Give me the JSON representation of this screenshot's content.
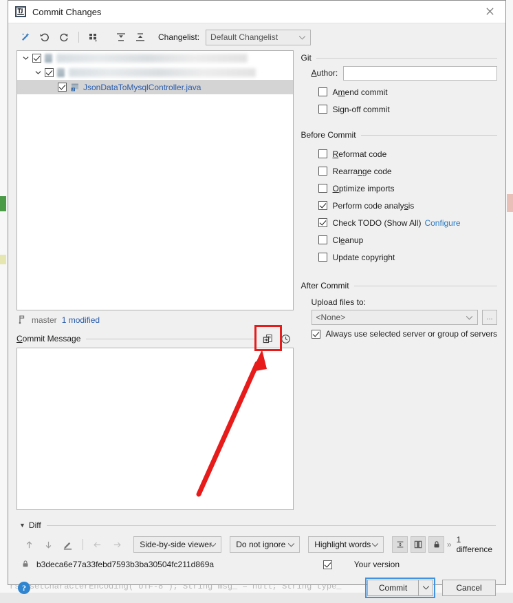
{
  "window": {
    "title": "Commit Changes",
    "app_icon": "intellij-idea-icon",
    "close_icon": "close-icon"
  },
  "toolbar": {
    "buttons": [
      {
        "name": "magic-wand-icon",
        "tooltip": "Refresh changes"
      },
      {
        "name": "rollback-icon",
        "tooltip": "Rollback"
      },
      {
        "name": "refresh-icon",
        "tooltip": "Refresh"
      },
      {
        "name": "group-by-icon",
        "tooltip": "Group By"
      },
      {
        "name": "expand-all-icon",
        "tooltip": "Expand All"
      },
      {
        "name": "collapse-all-icon",
        "tooltip": "Collapse All"
      }
    ],
    "changelist_label": "Changelist:",
    "changelist_value": "Default Changelist"
  },
  "tree": {
    "rows": [
      {
        "type": "redacted",
        "checked": true,
        "expanded": true,
        "indent": 0,
        "label": ""
      },
      {
        "type": "redacted",
        "checked": true,
        "expanded": true,
        "indent": 1,
        "label": ""
      },
      {
        "type": "file",
        "checked": true,
        "selected": true,
        "indent": 2,
        "label": "JsonDataToMysqlController.java"
      }
    ]
  },
  "branch_bar": {
    "branch_icon": "branch-icon",
    "branch": "master",
    "status": "1 modified"
  },
  "commit_message": {
    "label": "Commit Message",
    "value": "",
    "placeholder": "",
    "actions": [
      {
        "name": "insert-message-icon",
        "highlighted": true
      },
      {
        "name": "history-clock-icon",
        "highlighted": false
      }
    ]
  },
  "git_group": {
    "title": "Git",
    "author_label": "Author:",
    "author_value": "",
    "checkboxes": [
      {
        "label": "Amend commit",
        "checked": false,
        "mnemonic_index": 1
      },
      {
        "label": "Sign-off commit",
        "checked": false,
        "mnemonic_index": 3
      }
    ]
  },
  "before_commit_group": {
    "title": "Before Commit",
    "checkboxes": [
      {
        "label": "Reformat code",
        "checked": false
      },
      {
        "label": "Rearrange code",
        "checked": false
      },
      {
        "label": "Optimize imports",
        "checked": false
      },
      {
        "label": "Perform code analysis",
        "checked": true
      },
      {
        "label": "Check TODO (Show All)",
        "checked": true,
        "link": "Configure"
      },
      {
        "label": "Cleanup",
        "checked": false
      },
      {
        "label": "Update copyright",
        "checked": false
      }
    ]
  },
  "after_commit_group": {
    "title": "After Commit",
    "upload_label": "Upload files to:",
    "upload_value": "<None>",
    "browse_label": "...",
    "always_use_label": "Always use selected server or group of servers",
    "always_use_checked": true
  },
  "diff": {
    "section_label": "Diff",
    "expanded": true,
    "toolbar": {
      "icons": [
        {
          "name": "previous-difference-icon"
        },
        {
          "name": "next-difference-icon"
        },
        {
          "name": "edit-source-icon"
        },
        {
          "name": "accept-left-icon"
        },
        {
          "name": "accept-right-icon"
        }
      ],
      "viewer_mode": "Side-by-side viewer",
      "ignore_mode": "Do not ignore",
      "highlight_mode": "Highlight words",
      "toggles": [
        {
          "name": "collapse-unchanged-icon"
        },
        {
          "name": "synchronize-scrolling-icon"
        },
        {
          "name": "read-only-lock-icon"
        }
      ],
      "difference_count": "1 difference",
      "chevron": "»"
    },
    "revision": {
      "lock_icon": "lock-icon",
      "hash": "b3deca6e77a33febd7593b3ba30504fc211d869a",
      "your_version_label": "Your version",
      "your_version_checked": true
    }
  },
  "footer": {
    "help_label": "?",
    "commit_label": "Commit",
    "commit_dropdown_icon": "chevron-down-icon",
    "cancel_label": "Cancel"
  },
  "annotation": {
    "arrow_color": "#e81b1b",
    "highlight_color": "#e81b1b"
  },
  "backdrop": {
    "code_ghost": "rsp.setCharacterEncoding(\"UTF-8\");  String msg_ = null;  String type_"
  },
  "colors": {
    "accent_blue": "#2b5dab",
    "link_blue": "#2b7bc4",
    "focus_blue": "#3f93e0",
    "dialog_bg": "#f0f0f0",
    "field_bg": "#ffffff"
  }
}
